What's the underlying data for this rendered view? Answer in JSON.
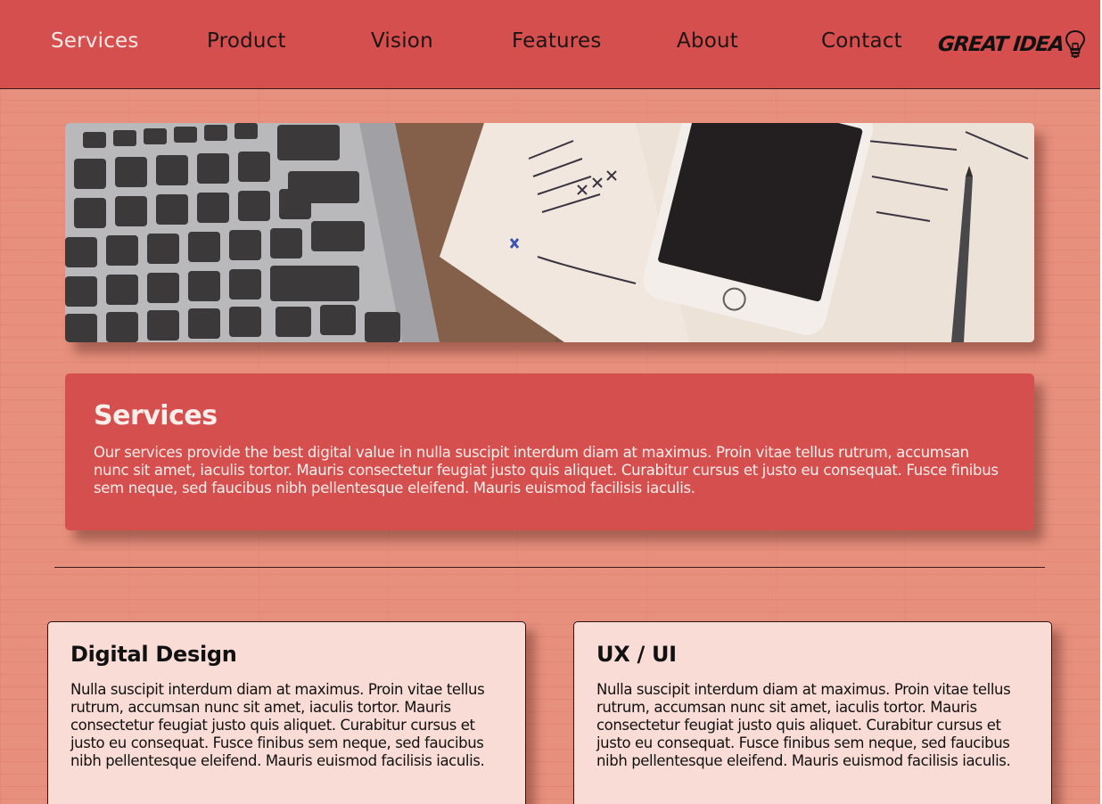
{
  "nav": {
    "items": [
      {
        "label": "Services",
        "active": true
      },
      {
        "label": "Product",
        "active": false
      },
      {
        "label": "Vision",
        "active": false
      },
      {
        "label": "Features",
        "active": false
      },
      {
        "label": "About",
        "active": false
      },
      {
        "label": "Contact",
        "active": false
      }
    ],
    "logo_text": "GREAT IDEA",
    "logo_icon": "lightbulb-icon"
  },
  "banner": {
    "image": "laptop-phone-notebook-photo"
  },
  "services": {
    "title": "Services",
    "text": "Our services provide the best digital value in nulla suscipit interdum diam at maximus. Proin vitae tellus rutrum, accumsan nunc sit amet, iaculis tortor. Mauris consectetur feugiat justo quis aliquet. Curabitur cursus et justo eu consequat. Fusce finibus sem neque, sed faucibus nibh pellentesque eleifend. Mauris euismod facilisis iaculis."
  },
  "cards": [
    {
      "title": "Digital Design",
      "text": "Nulla suscipit interdum diam at maximus. Proin vitae tellus rutrum, accumsan nunc sit amet, iaculis tortor. Mauris consectetur feugiat justo quis aliquet. Curabitur cursus et justo eu consequat. Fusce finibus sem neque, sed faucibus nibh pellentesque eleifend. Mauris euismod facilisis iaculis."
    },
    {
      "title": "UX / UI",
      "text": "Nulla suscipit interdum diam at maximus. Proin vitae tellus rutrum, accumsan nunc sit amet, iaculis tortor. Mauris consectetur feugiat justo quis aliquet. Curabitur cursus et justo eu consequat. Fusce finibus sem neque, sed faucibus nibh pellentesque eleifend. Mauris euismod facilisis iaculis."
    }
  ],
  "colors": {
    "header_bg": "#d64f4f",
    "page_bg": "#e8907e",
    "card_bg": "#f9dcd6",
    "active_nav": "#fbe9e6"
  }
}
